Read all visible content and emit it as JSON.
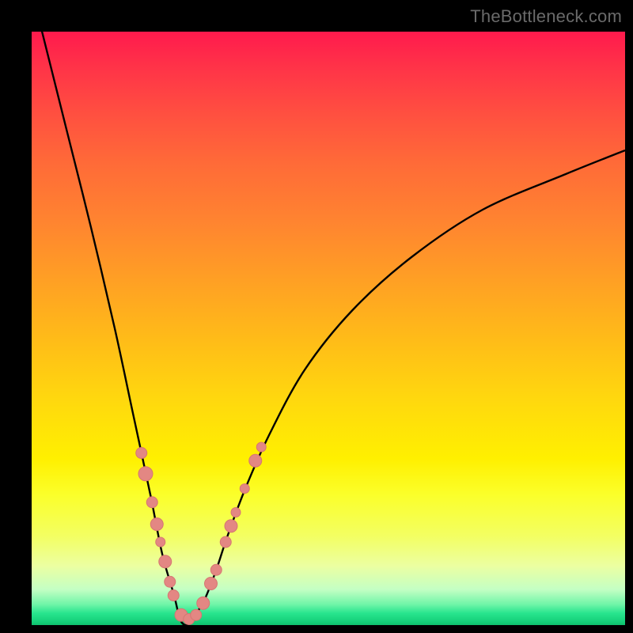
{
  "watermark": "TheBottleneck.com",
  "colors": {
    "frame": "#000000",
    "curve": "#000000",
    "marker_fill": "#e38783",
    "marker_stroke": "#d67672"
  },
  "chart_data": {
    "type": "line",
    "title": "",
    "xlabel": "",
    "ylabel": "",
    "xlim": [
      0,
      100
    ],
    "ylim": [
      0,
      100
    ],
    "series": [
      {
        "name": "bottleneck-curve",
        "x": [
          0,
          6,
          10,
          14,
          17,
          20,
          22,
          24,
          25,
          26,
          27,
          29,
          31,
          33,
          36,
          40,
          46,
          54,
          64,
          76,
          90,
          100
        ],
        "y": [
          107,
          83,
          67,
          50,
          36,
          22,
          12,
          5,
          1,
          0,
          1,
          4,
          9,
          15,
          23,
          32,
          43,
          53,
          62,
          70,
          76,
          80
        ]
      }
    ],
    "markers": [
      {
        "x": 18.5,
        "y": 29.0,
        "r": 7
      },
      {
        "x": 19.2,
        "y": 25.5,
        "r": 9
      },
      {
        "x": 20.3,
        "y": 20.7,
        "r": 7
      },
      {
        "x": 21.1,
        "y": 17.0,
        "r": 8
      },
      {
        "x": 21.7,
        "y": 14.0,
        "r": 6
      },
      {
        "x": 22.5,
        "y": 10.7,
        "r": 8
      },
      {
        "x": 23.3,
        "y": 7.3,
        "r": 7
      },
      {
        "x": 23.9,
        "y": 5.0,
        "r": 7
      },
      {
        "x": 25.2,
        "y": 1.7,
        "r": 8
      },
      {
        "x": 26.5,
        "y": 1.0,
        "r": 7
      },
      {
        "x": 27.7,
        "y": 1.7,
        "r": 7
      },
      {
        "x": 28.9,
        "y": 3.7,
        "r": 8
      },
      {
        "x": 30.2,
        "y": 7.0,
        "r": 8
      },
      {
        "x": 31.1,
        "y": 9.3,
        "r": 7
      },
      {
        "x": 32.7,
        "y": 14.0,
        "r": 7
      },
      {
        "x": 33.6,
        "y": 16.7,
        "r": 8
      },
      {
        "x": 34.4,
        "y": 19.0,
        "r": 6
      },
      {
        "x": 35.9,
        "y": 23.0,
        "r": 6
      },
      {
        "x": 37.7,
        "y": 27.7,
        "r": 8
      },
      {
        "x": 38.7,
        "y": 30.0,
        "r": 6
      }
    ]
  }
}
